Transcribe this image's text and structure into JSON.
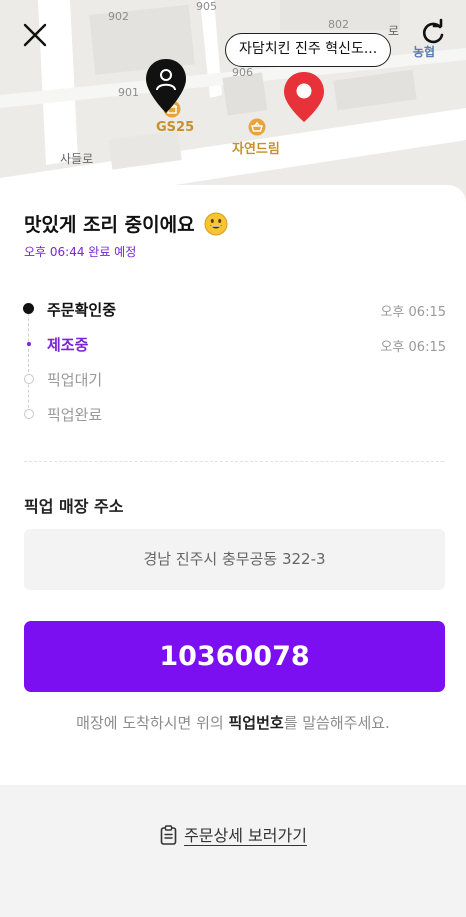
{
  "map": {
    "block_numbers": [
      "902",
      "905",
      "802",
      "906",
      "901"
    ],
    "poi_gs25": "GS25",
    "poi_market": "자연드림",
    "road_name": "사들로",
    "nh_label": "농협",
    "road_edge_label": "로",
    "store_bubble": "자담치킨 진주 혁신도..."
  },
  "status": {
    "title": "맛있게 조리 중이에요",
    "eta": "오후 06:44 완료 예정"
  },
  "steps": [
    {
      "label": "주문확인중",
      "time": "오후 06:15",
      "state": "done"
    },
    {
      "label": "제조중",
      "time": "오후 06:15",
      "state": "current"
    },
    {
      "label": "픽업대기",
      "time": "",
      "state": "todo"
    },
    {
      "label": "픽업완료",
      "time": "",
      "state": "todo"
    }
  ],
  "address": {
    "title": "픽업 매장 주소",
    "value": "경남 진주시 충무공동 322-3"
  },
  "pickup": {
    "number": "10360078",
    "notice_before": "매장에 도착하시면 위의 ",
    "notice_bold": "픽업번호",
    "notice_after": "를 말씀해주세요."
  },
  "footer": {
    "detail_link": "주문상세 보러가기"
  },
  "colors": {
    "accent": "#7b0ff2",
    "accent_text": "#7b24d8",
    "pin_red": "#e8323a"
  },
  "icons": [
    "close-icon",
    "refresh-icon",
    "user-location-pin-icon",
    "destination-pin-icon",
    "convenience-store-icon",
    "market-icon",
    "smile-emoji-icon",
    "clipboard-icon"
  ]
}
